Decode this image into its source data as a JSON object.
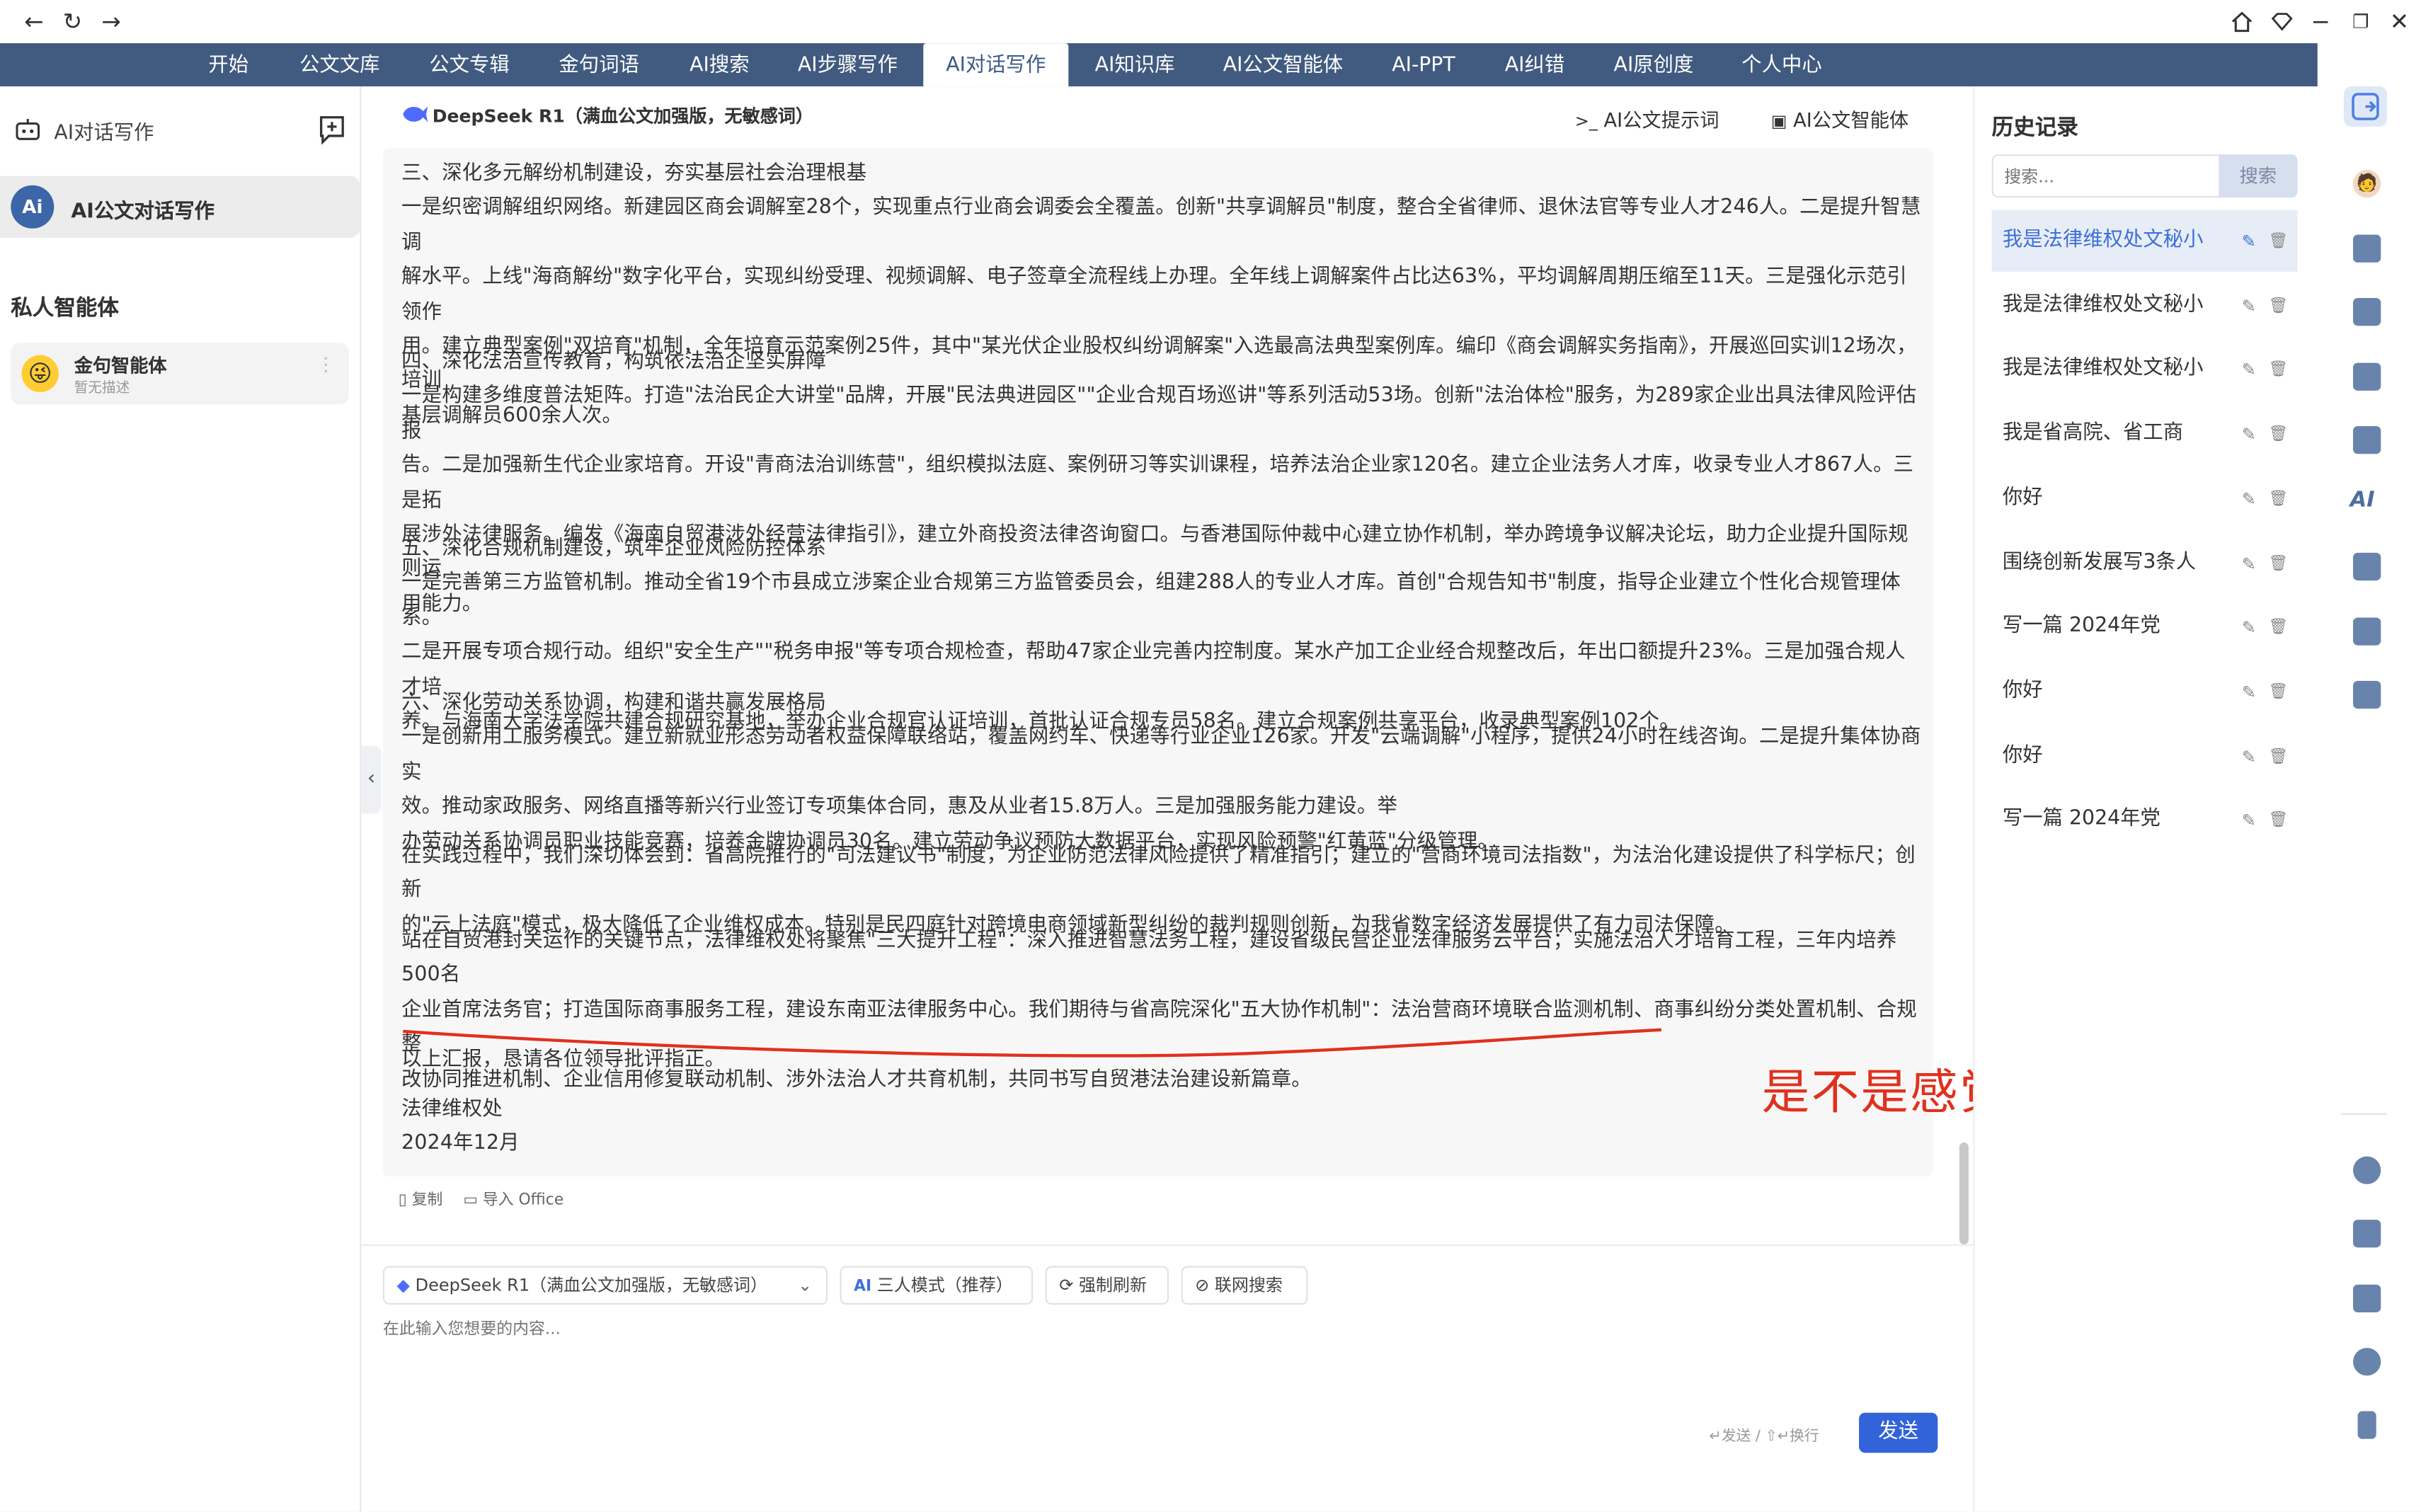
{
  "colors": {
    "nav_bg": "#415a7f",
    "accent": "#3e6fd8",
    "annotation": "#e0311e"
  },
  "topnav": {
    "items": [
      "开始",
      "公文文库",
      "公文专辑",
      "金句词语",
      "AI搜索",
      "AI步骤写作",
      "AI对话写作",
      "AI知识库",
      "AI公文智能体",
      "AI-PPT",
      "AI纠错",
      "AI原创度",
      "个人中心"
    ],
    "active_index": 6
  },
  "left": {
    "header": "AI对话写作",
    "selected_agent": "AI公文对话写作",
    "avatar_text": "Ai",
    "section_title": "私人智能体",
    "private_agent": {
      "name": "金句智能体",
      "desc": "暂无描述"
    }
  },
  "center": {
    "model_name": "DeepSeek R1（满血公文加强版，无敏感词）",
    "prompt_link": "AI公文提示词",
    "agent_link": "AI公文智能体",
    "paragraphs": [
      {
        "title": "三、深化多元解纷机制建设，夯实基层社会治理根基",
        "body": [
          "一是织密调解组织网络。新建园区商会调解室28个，实现重点行业商会调委会全覆盖。创新\"共享调解员\"制度，整合全省律师、退休法官等专业人才246人。二是提升智慧调",
          "解水平。上线\"海商解纷\"数字化平台，实现纠纷受理、视频调解、电子签章全流程线上办理。全年线上调解案件占比达63%，平均调解周期压缩至11天。三是强化示范引领作",
          "用。建立典型案例\"双培育\"机制，全年培育示范案例25件，其中\"某光伏企业股权纠纷调解案\"入选最高法典型案例库。编印《商会调解实务指南》，开展巡回实训12场次，培训",
          "基层调解员600余人次。"
        ]
      },
      {
        "title": "四、深化法治宣传教育，构筑依法治企坚实屏障",
        "body": [
          "一是构建多维度普法矩阵。打造\"法治民企大讲堂\"品牌，开展\"民法典进园区\"\"企业合规百场巡讲\"等系列活动53场。创新\"法治体检\"服务，为289家企业出具法律风险评估报",
          "告。二是加强新生代企业家培育。开设\"青商法治训练营\"，组织模拟法庭、案例研习等实训课程，培养法治企业家120名。建立企业法务人才库，收录专业人才867人。三是拓",
          "展涉外法律服务。编发《海南自贸港涉外经营法律指引》，建立外商投资法律咨询窗口。与香港国际仲裁中心建立协作机制，举办跨境争议解决论坛，助力企业提升国际规则运",
          "用能力。"
        ]
      },
      {
        "title": "五、深化合规机制建设，筑牢企业风险防控体系",
        "body": [
          "一是完善第三方监管机制。推动全省19个市县成立涉案企业合规第三方监管委员会，组建288人的专业人才库。首创\"合规告知书\"制度，指导企业建立个性化合规管理体系。",
          "二是开展专项合规行动。组织\"安全生产\"\"税务申报\"等专项合规检查，帮助47家企业完善内控制度。某水产加工企业经合规整改后，年出口额提升23%。三是加强合规人才培",
          "养。与海南大学法学院共建合规研究基地，举办企业合规官认证培训，首批认证合规专员58名。建立合规案例共享平台，收录典型案例102个。"
        ]
      },
      {
        "title": "六、深化劳动关系协调，构建和谐共赢发展格局",
        "body": [
          "一是创新用工服务模式。建立新就业形态劳动者权益保障联络站，覆盖网约车、快递等行业企业126家。开发\"云端调解\"小程序，提供24小时在线咨询。二是提升集体协商实",
          "效。推动家政服务、网络直播等新兴行业签订专项集体合同，惠及从业者15.8万人。三是加强服务能力建设。举",
          "办劳动关系协调员职业技能竞赛，培养金牌协调员30名。建立劳动争议预防大数据平台，实现风险预警\"红黄蓝\"分级管理。"
        ]
      },
      {
        "title": "",
        "body": [
          "在实践过程中，我们深切体会到：省高院推行的\"司法建议书\"制度，为企业防范法律风险提供了精准指引；建立的\"营商环境司法指数\"，为法治化建设提供了科学标尺；创新",
          "的\"云上法庭\"模式，极大降低了企业维权成本。特别是民四庭针对跨境电商领域新型纠纷的裁判规则创新，为我省数字经济发展提供了有力司法保障。"
        ]
      },
      {
        "title": "",
        "body": [
          "站在自贸港封关运作的关键节点，法律维权处将聚焦\"三大提升工程\"：深入推进智慧法务工程，建设省级民营企业法律服务云平台；实施法治人才培育工程，三年内培养500名",
          "企业首席法务官；打造国际商事服务工程，建设东南亚法律服务中心。我们期待与省高院深化\"五大协作机制\"：法治营商环境联合监测机制、商事纠纷分类处置机制、合规整",
          "改协同推进机制、企业信用修复联动机制、涉外法治人才共育机制，共同书写自贸港法治建设新篇章。"
        ]
      },
      {
        "title": "",
        "body": [
          "以上汇报，恳请各位领导批评指正。"
        ]
      },
      {
        "title": "",
        "body": [
          "法律维权处",
          "2024年12月"
        ]
      }
    ],
    "copy_label": "复制",
    "import_label": "导入 Office",
    "annotation": "是不是感觉没写完",
    "model_select": "DeepSeek R1（满血公文加强版，无敏感词）",
    "mode_label": "三人模式（推荐）",
    "refresh_label": "强制刷新",
    "web_search_label": "联网搜索",
    "input_placeholder": "在此输入您想要的内容...",
    "send_hint": "↵发送 / ⇧↵换行",
    "send_label": "发送"
  },
  "history": {
    "title": "历史记录",
    "search_placeholder": "搜索...",
    "search_button": "搜索",
    "items": [
      "我是法律维权处文秘小",
      "我是法律维权处文秘小",
      "我是法律维权处文秘小",
      "我是省高院、省工商",
      "你好",
      "围绕创新发展写3条人",
      "写一篇 2024年党",
      "你好",
      "你好",
      "写一篇 2024年党"
    ],
    "active_index": 0
  }
}
